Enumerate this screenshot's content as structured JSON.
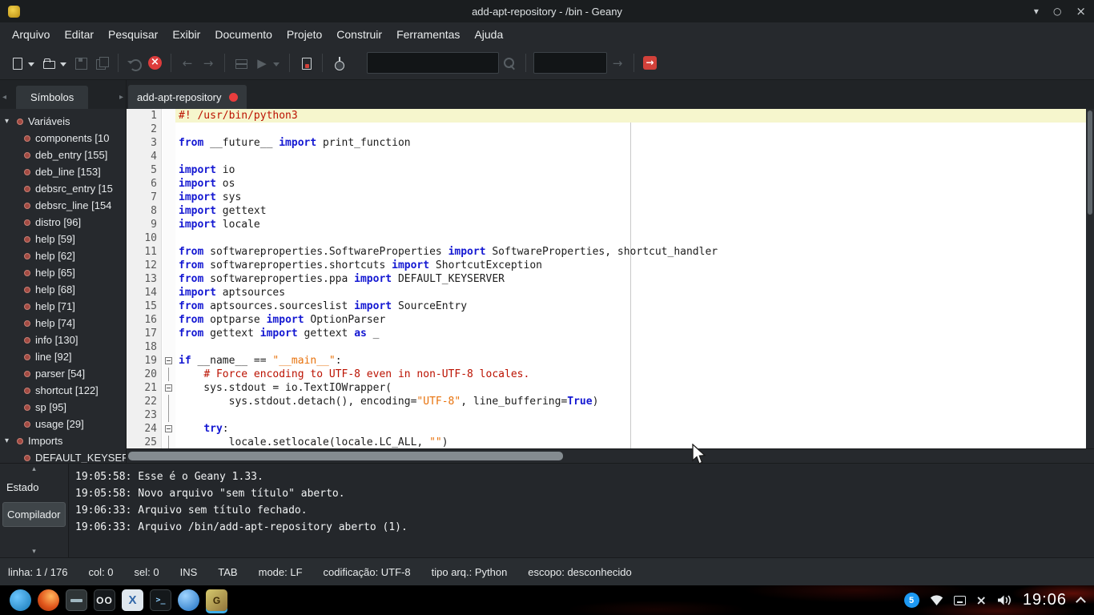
{
  "titlebar": {
    "title": "add-apt-repository - /bin - Geany"
  },
  "menubar": {
    "items": [
      "Arquivo",
      "Editar",
      "Pesquisar",
      "Exibir",
      "Documento",
      "Projeto",
      "Construir",
      "Ferramentas",
      "Ajuda"
    ]
  },
  "toolbar": {
    "buttons": [
      "new-file",
      "open-file",
      "save",
      "save-all",
      "revert",
      "close-file",
      "navigate-back",
      "navigate-forward",
      "compile",
      "execute",
      "jump-to-line",
      "color-chooser",
      "search",
      "goto-line",
      "quit"
    ],
    "search_value": "",
    "goto_value": ""
  },
  "sidebar": {
    "tab_label": "Símbolos",
    "groups": [
      {
        "label": "Variáveis",
        "items": [
          "components [10",
          "deb_entry [155]",
          "deb_line [153]",
          "debsrc_entry [15",
          "debsrc_line [154",
          "distro [96]",
          "help [59]",
          "help [62]",
          "help [65]",
          "help [68]",
          "help [71]",
          "help [74]",
          "info [130]",
          "line [92]",
          "parser [54]",
          "shortcut [122]",
          "sp [95]",
          "usage [29]"
        ]
      },
      {
        "label": "Imports",
        "items": [
          "DEFAULT_KEYSER"
        ]
      }
    ]
  },
  "editor": {
    "tab_label": "add-apt-repository",
    "long_line_column": 72,
    "lines": [
      {
        "n": 1,
        "cur": true,
        "fold": "",
        "t": [
          [
            "c",
            "#! /usr/bin/python3"
          ]
        ]
      },
      {
        "n": 2,
        "fold": "",
        "t": []
      },
      {
        "n": 3,
        "fold": "",
        "t": [
          [
            "k",
            "from"
          ],
          [
            "p",
            " __future__ "
          ],
          [
            "k",
            "import"
          ],
          [
            "p",
            " print_function"
          ]
        ]
      },
      {
        "n": 4,
        "fold": "",
        "t": []
      },
      {
        "n": 5,
        "fold": "",
        "t": [
          [
            "k",
            "import"
          ],
          [
            "p",
            " io"
          ]
        ]
      },
      {
        "n": 6,
        "fold": "",
        "t": [
          [
            "k",
            "import"
          ],
          [
            "p",
            " os"
          ]
        ]
      },
      {
        "n": 7,
        "fold": "",
        "t": [
          [
            "k",
            "import"
          ],
          [
            "p",
            " sys"
          ]
        ]
      },
      {
        "n": 8,
        "fold": "",
        "t": [
          [
            "k",
            "import"
          ],
          [
            "p",
            " gettext"
          ]
        ]
      },
      {
        "n": 9,
        "fold": "",
        "t": [
          [
            "k",
            "import"
          ],
          [
            "p",
            " locale"
          ]
        ]
      },
      {
        "n": 10,
        "fold": "",
        "t": []
      },
      {
        "n": 11,
        "fold": "",
        "t": [
          [
            "k",
            "from"
          ],
          [
            "p",
            " softwareproperties.SoftwareProperties "
          ],
          [
            "k",
            "import"
          ],
          [
            "p",
            " SoftwareProperties, shortcut_handler"
          ]
        ]
      },
      {
        "n": 12,
        "fold": "",
        "t": [
          [
            "k",
            "from"
          ],
          [
            "p",
            " softwareproperties.shortcuts "
          ],
          [
            "k",
            "import"
          ],
          [
            "p",
            " ShortcutException"
          ]
        ]
      },
      {
        "n": 13,
        "fold": "",
        "t": [
          [
            "k",
            "from"
          ],
          [
            "p",
            " softwareproperties.ppa "
          ],
          [
            "k",
            "import"
          ],
          [
            "p",
            " DEFAULT_KEYSERVER"
          ]
        ]
      },
      {
        "n": 14,
        "fold": "",
        "t": [
          [
            "k",
            "import"
          ],
          [
            "p",
            " aptsources"
          ]
        ]
      },
      {
        "n": 15,
        "fold": "",
        "t": [
          [
            "k",
            "from"
          ],
          [
            "p",
            " aptsources.sourceslist "
          ],
          [
            "k",
            "import"
          ],
          [
            "p",
            " SourceEntry"
          ]
        ]
      },
      {
        "n": 16,
        "fold": "",
        "t": [
          [
            "k",
            "from"
          ],
          [
            "p",
            " optparse "
          ],
          [
            "k",
            "import"
          ],
          [
            "p",
            " OptionParser"
          ]
        ]
      },
      {
        "n": 17,
        "fold": "",
        "t": [
          [
            "k",
            "from"
          ],
          [
            "p",
            " gettext "
          ],
          [
            "k",
            "import"
          ],
          [
            "p",
            " gettext "
          ],
          [
            "k",
            "as"
          ],
          [
            "p",
            " _"
          ]
        ]
      },
      {
        "n": 18,
        "fold": "",
        "t": []
      },
      {
        "n": 19,
        "fold": "box",
        "t": [
          [
            "k",
            "if"
          ],
          [
            "p",
            " __name__ == "
          ],
          [
            "s",
            "\"__main__\""
          ],
          [
            "p",
            ":"
          ]
        ]
      },
      {
        "n": 20,
        "fold": "line",
        "t": [
          [
            "p",
            "    "
          ],
          [
            "c",
            "# Force encoding to UTF-8 even in non-UTF-8 locales."
          ]
        ]
      },
      {
        "n": 21,
        "fold": "box",
        "t": [
          [
            "p",
            "    sys.stdout = io.TextIOWrapper("
          ]
        ]
      },
      {
        "n": 22,
        "fold": "line",
        "t": [
          [
            "p",
            "        sys.stdout.detach(), encoding="
          ],
          [
            "s",
            "\"UTF-8\""
          ],
          [
            "p",
            ", line_buffering="
          ],
          [
            "k",
            "True"
          ],
          [
            "p",
            ")"
          ]
        ]
      },
      {
        "n": 23,
        "fold": "line",
        "t": []
      },
      {
        "n": 24,
        "fold": "box",
        "t": [
          [
            "p",
            "    "
          ],
          [
            "k",
            "try"
          ],
          [
            "p",
            ":"
          ]
        ]
      },
      {
        "n": 25,
        "fold": "line",
        "t": [
          [
            "p",
            "        locale.setlocale(locale.LC_ALL, "
          ],
          [
            "s",
            "\"\""
          ],
          [
            "p",
            ")"
          ]
        ]
      }
    ]
  },
  "messages": {
    "tabs": [
      {
        "label": "Estado",
        "selected": false
      },
      {
        "label": "Compilador",
        "selected": true
      }
    ],
    "lines": [
      "19:05:58: Esse é o Geany 1.33.",
      "19:05:58: Novo arquivo \"sem título\" aberto.",
      "19:06:33: Arquivo sem título fechado.",
      "19:06:33: Arquivo /bin/add-apt-repository aberto (1)."
    ]
  },
  "statusbar": {
    "fields": [
      "linha: 1 / 176",
      "col: 0",
      "sel: 0",
      "INS",
      "TAB",
      "mode: LF",
      "codificação: UTF-8",
      "tipo arq.: Python",
      "escopo: desconhecido"
    ]
  },
  "taskbar": {
    "clock": "19:06",
    "badge": "5"
  },
  "colors": {
    "accent": "#3daee9",
    "keyword_blue": "#1418d2",
    "comment_red": "#bb1100",
    "string_orange": "#e8720c",
    "close_red": "#dd3c3c",
    "badge_blue": "#1d99f3"
  }
}
